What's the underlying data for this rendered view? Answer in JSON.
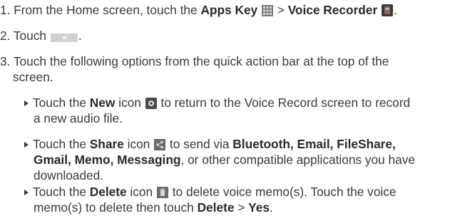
{
  "steps": [
    {
      "number": "1.",
      "prefix": "From the Home screen, touch the ",
      "apps_key": "Apps Key",
      "separator": " > ",
      "voice_recorder": "Voice Recorder",
      "suffix": "."
    },
    {
      "number": "2.",
      "prefix": "Touch",
      "suffix": "."
    },
    {
      "number": "3.",
      "text_line1": "Touch the following options from the quick action bar at the top of the",
      "text_line2": "screen."
    }
  ],
  "bullets": [
    {
      "touch": "Touch the ",
      "bold": "New",
      "icon_word": " icon ",
      "line1_rest": " to return to the Voice Record screen to record",
      "line2": "a new audio file."
    },
    {
      "touch": "Touch the ",
      "bold": "Share",
      "icon_word": " icon ",
      "line1_to": " to send via ",
      "line1_bold": "Bluetooth, Email, FileShare,",
      "line2_bold": "Gmail, Memo, Messaging",
      "line2_rest": ", or other compatible applications you have",
      "line3": "downloaded."
    },
    {
      "touch": "Touch the ",
      "bold": "Delete",
      "icon_word": " icon ",
      "line1_rest": " to delete voice memo(s). Touch the voice",
      "line2_a": "memo(s) to delete then touch ",
      "line2_bold1": "Delete",
      "line2_sep": " > ",
      "line2_bold2": "Yes",
      "line2_end": "."
    }
  ],
  "icons": {
    "apps_key": "apps-grid-icon",
    "voice_recorder": "voice-recorder-icon",
    "list_button": "list-button-icon",
    "new": "new-record-icon",
    "share": "share-icon",
    "delete": "delete-icon"
  }
}
